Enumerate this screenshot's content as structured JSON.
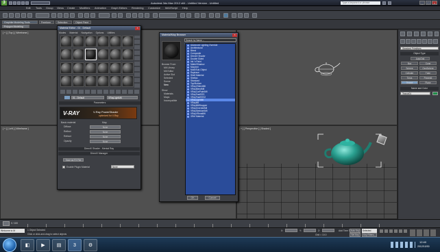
{
  "window": {
    "title": "Autodesk 3ds Max  2012 x64  -  Untitled Version  -  Untitled",
    "search_placeholder": "Type a keyword or phrase",
    "minimize": "_",
    "maximize": "□",
    "close": "×"
  },
  "menus": [
    "Edit",
    "Tools",
    "Group",
    "Views",
    "Create",
    "Modifiers",
    "Animation",
    "Graph Editors",
    "Rendering",
    "Customize",
    "MAXScript",
    "Help"
  ],
  "ribbon": {
    "tabs": [
      "Graphite Modeling Tools",
      "Freeform",
      "Selection",
      "Object Paint"
    ],
    "active_tab": "Polygon Modeling"
  },
  "viewports": {
    "top_left": "[ + ] [ Top ] [ Wireframe ]",
    "bottom_left": "[ + ] [ Left ] [ Wireframe ]",
    "bottom_right": "[ + ] [ Perspective ] [ Shaded ]"
  },
  "material_editor": {
    "title": "Material Editor - 01 - Default",
    "menu": [
      "Modes",
      "Material",
      "Navigation",
      "Options",
      "Utilities"
    ],
    "material_name": "01 - Default",
    "shader_type": "VRayLightMtl",
    "rollout_title": "Parameters",
    "banner_brand": "V-RAY",
    "banner_line1": "V-Ray PowerShader",
    "banner_line2": "optimized for V-Ray",
    "basic_params_label": "Basic material",
    "column_label": "Map",
    "rows": [
      {
        "label": "Diffuse",
        "value": "None"
      },
      {
        "label": "Reflect",
        "value": "None"
      },
      {
        "label": "Refract",
        "value": "None"
      },
      {
        "label": "Opacity",
        "value": "None"
      }
    ],
    "direct_shader_label": "DirectX Shader - Mental Ray",
    "direct_manager_label": "DirectX Manager",
    "enable_plugin_label": "Enable Plugin Material",
    "plugin_value": "None",
    "save_fx": "Save as FX File"
  },
  "browser": {
    "title": "Material/Map Browser",
    "search_label": "Search by Name ...",
    "filter_label": "Browse From:",
    "filter_options": [
      "Mtl Library",
      "Mtl Editor",
      "Active Slot",
      "Selected",
      "Scene",
      "New"
    ],
    "show_label": "Show",
    "show_options": [
      "Materials",
      "Maps",
      "Incompatible"
    ],
    "list_label": "Materials",
    "items": [
      "Advanced Lighting Override",
      "Architectural",
      "Blend",
      "Composite",
      "DirectX Shader",
      "Double Sided",
      "Ink 'n Paint",
      "Matte/Shadow",
      "Morpher",
      "Multi/Sub-Object",
      "Raytrace",
      "Shell Material",
      "Shellac",
      "Standard",
      "Top/Bottom",
      "VRay2SidedMtl",
      "VRayBlendMtl",
      "VRayCarPaintMtl",
      "VRayFastSSS",
      "VRayFastSSS2",
      "VRayLightMtl",
      "VRayMtl",
      "VRayMtlWrapper",
      "VRayOverrideMtl",
      "VRaySimbiontMtl",
      "VRayVRmatMtl",
      "XRef Material"
    ],
    "highlighted": "VRayLightMtl",
    "ok": "OK",
    "cancel": "Cancel"
  },
  "command_panel": {
    "dropdown": "Standard Primitives",
    "rollout_object_type": "Object Type",
    "autogrid": "AutoGrid",
    "buttons": [
      "Box",
      "Cone",
      "Sphere",
      "GeoSphere",
      "Cylinder",
      "Tube",
      "Torus",
      "Pyramid",
      "Teapot",
      "Plane"
    ],
    "rollout_name_color": "Name and Color",
    "object_name": "Teapot01",
    "object_color": "#1f8f4a"
  },
  "timeline": {
    "frame_counter": "0 / 100",
    "ticks": [
      "0",
      "5",
      "10",
      "15",
      "20",
      "25",
      "30",
      "35",
      "40",
      "45",
      "50",
      "55",
      "60",
      "65",
      "70",
      "75",
      "80",
      "85",
      "90",
      "95",
      "100"
    ]
  },
  "status": {
    "selection": "1 Object Selected",
    "prompt": "Click or click-and-drag to select objects",
    "welcome": "Welcome to M",
    "x_label": "X:",
    "y_label": "Y:",
    "z_label": "Z:",
    "grid": "Grid = 10.0",
    "autokey": "Auto Key",
    "selected": "Selected",
    "set_key": "Set Key",
    "key_filters": "Key Filters...",
    "add_time_tag": "Add Time Tag"
  },
  "taskbar": {
    "clock_time": "12:40",
    "clock_date": "2012/10/30",
    "apps": [
      "explorer",
      "media",
      "folder",
      "3dsmax",
      "settings"
    ]
  },
  "colors": {
    "teapot": "#2aa090",
    "list_bg": "#2a4c9a",
    "list_highlight": "#5b88e8"
  }
}
